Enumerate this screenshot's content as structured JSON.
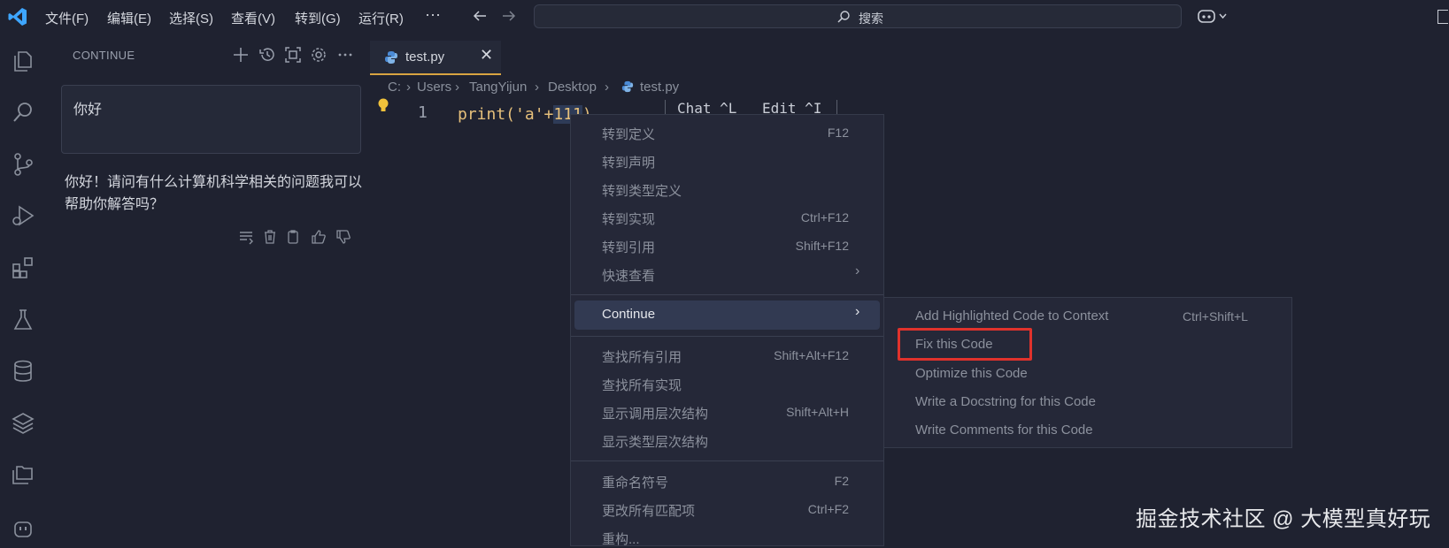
{
  "titlebar": {
    "menus": [
      "文件(F)",
      "编辑(E)",
      "选择(S)",
      "查看(V)",
      "转到(G)",
      "运行(R)",
      "···"
    ],
    "search_label": "搜索"
  },
  "sidepanel": {
    "title": "CONTINUE",
    "user_message": "你好",
    "assistant_reply": "你好！请问有什么计算机科学相关的问题我可以帮助你解答吗？"
  },
  "editor": {
    "tab_name": "test.py",
    "tab_close": "✕",
    "breadcrumb": [
      "C:",
      "Users",
      "TangYijun",
      "Desktop",
      "test.py"
    ],
    "line_number": "1",
    "code_before": "print('a'+",
    "code_selected": "111",
    "code_after": ")",
    "chat_hint": "Chat ^L",
    "edit_hint": "Edit ^I"
  },
  "context_menu": {
    "items": [
      {
        "label": "转到定义",
        "shortcut": "F12"
      },
      {
        "label": "转到声明",
        "shortcut": ""
      },
      {
        "label": "转到类型定义",
        "shortcut": ""
      },
      {
        "label": "转到实现",
        "shortcut": "Ctrl+F12"
      },
      {
        "label": "转到引用",
        "shortcut": "Shift+F12"
      },
      {
        "label": "快速查看",
        "shortcut": ""
      },
      {
        "label": "Continue",
        "shortcut": ""
      },
      {
        "label": "查找所有引用",
        "shortcut": "Shift+Alt+F12"
      },
      {
        "label": "查找所有实现",
        "shortcut": ""
      },
      {
        "label": "显示调用层次结构",
        "shortcut": "Shift+Alt+H"
      },
      {
        "label": "显示类型层次结构",
        "shortcut": ""
      },
      {
        "label": "重命名符号",
        "shortcut": "F2"
      },
      {
        "label": "更改所有匹配项",
        "shortcut": "Ctrl+F2"
      },
      {
        "label": "重构...",
        "shortcut": ""
      }
    ]
  },
  "submenu": {
    "items": [
      {
        "label": "Add Highlighted Code to Context",
        "shortcut": "Ctrl+Shift+L"
      },
      {
        "label": "Fix this Code",
        "shortcut": ""
      },
      {
        "label": "Optimize this Code",
        "shortcut": ""
      },
      {
        "label": "Write a Docstring for this Code",
        "shortcut": ""
      },
      {
        "label": "Write Comments for this Code",
        "shortcut": ""
      }
    ]
  },
  "watermark": "掘金技术社区 @ 大模型真好玩",
  "colors": {
    "accent_blue": "#3ea6ff",
    "highlight_red": "#e0322c",
    "tab_underline": "#d9a441"
  }
}
